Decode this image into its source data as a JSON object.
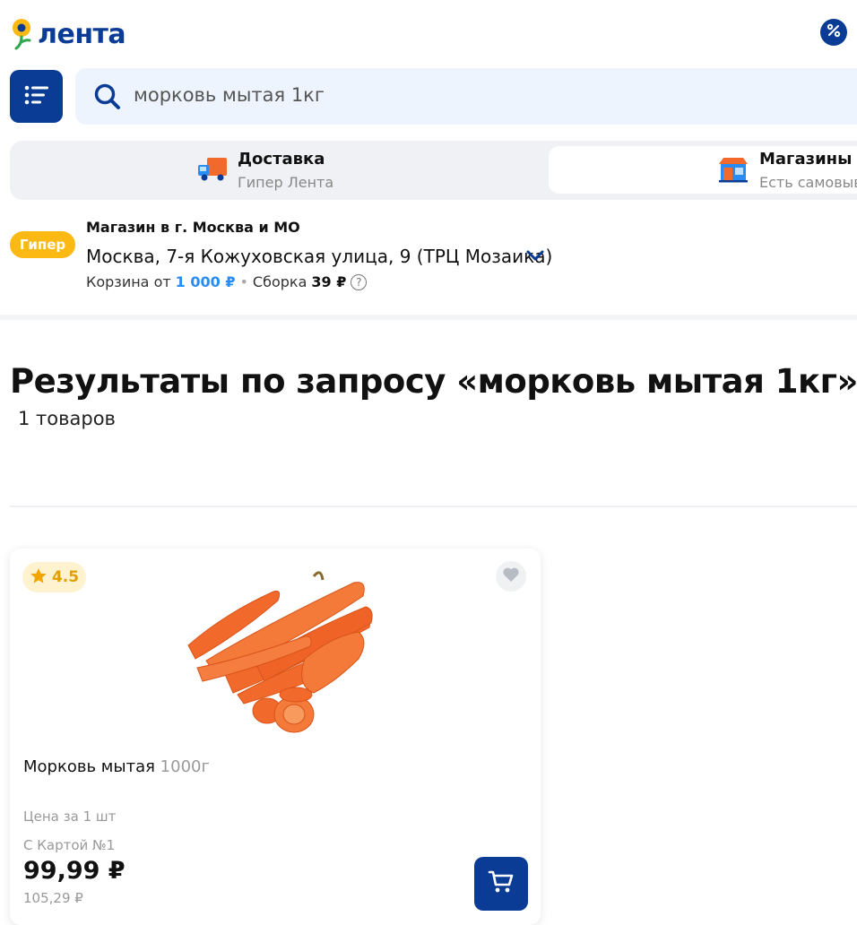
{
  "header": {
    "logo_text": "лента",
    "promo_icon": "percent-icon"
  },
  "search": {
    "menu_icon": "catalog-list-icon",
    "query": "морковь мытая 1кг",
    "search_icon": "search-icon"
  },
  "delivery_modes": [
    {
      "title": "Доставка",
      "subtitle": "Гипер Лента",
      "icon": "delivery-truck-icon"
    },
    {
      "title": "Магазины",
      "subtitle": "Есть самовывоз",
      "icon": "store-icon"
    }
  ],
  "store": {
    "badge": "Гипер",
    "city_label": "Магазин в г. Москва и МО",
    "address": "Москва, 7-я Кожуховская улица, 9 (ТРЦ Мозаика)",
    "basket_label": "Корзина от",
    "basket_min": "1 000 ₽",
    "assembly_label": "Сборка",
    "assembly_price": "39 ₽",
    "help_icon": "?",
    "separator": "•"
  },
  "results": {
    "title": "Результаты по запросу «морковь мытая 1кг»",
    "count": "1 товаров"
  },
  "products": [
    {
      "rating": "4.5",
      "name": "Морковь мытая",
      "weight": "1000г",
      "price_per": "Цена за 1 шт",
      "card_label": "С Картой №1",
      "price": "99,99 ₽",
      "old_price": "105,29 ₽",
      "image": "carrots-photo",
      "favorite_icon": "heart-icon",
      "cart_icon": "cart-icon"
    }
  ],
  "colors": {
    "brand_blue": "#0a3c95",
    "accent_yellow": "#fdb913",
    "price_blue": "#2a8bf2",
    "carrot": "#f26a2b"
  }
}
